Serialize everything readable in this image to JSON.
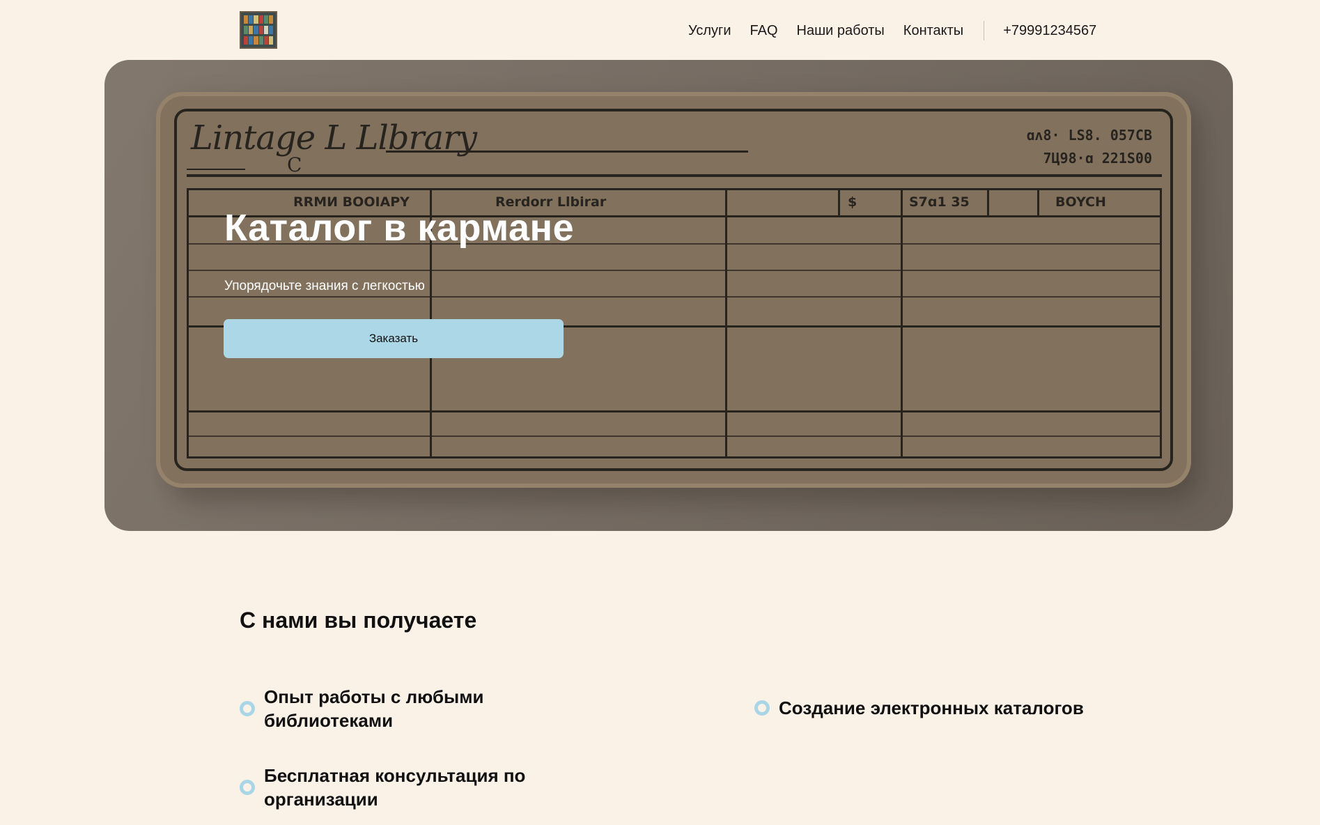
{
  "header": {
    "nav": [
      {
        "label": "Услуги"
      },
      {
        "label": "FAQ"
      },
      {
        "label": "Наши работы"
      },
      {
        "label": "Контакты"
      }
    ],
    "phone": "+79991234567"
  },
  "hero": {
    "title": "Каталог в кармане",
    "subtitle": "Упорядочьте знания с легкостью",
    "cta_label": "Заказать",
    "image": {
      "card_title": "Lintage L Llbrary",
      "card_letter": "C",
      "code_line_1": "ɑʌ8· LS8. 057CB",
      "code_line_2": "7Ц98·ɑ 221S00",
      "headers": [
        "RRMИ BOOIAPY",
        "Rerdorr Llbirar",
        "$",
        "S7ɑ1 35",
        "BOYCH"
      ]
    }
  },
  "benefits": {
    "title": "С нами вы получаете",
    "items": [
      {
        "text": "Опыт работы с любыми библиотеками"
      },
      {
        "text": "Создание электронных каталогов"
      },
      {
        "text": "Бесплатная консультация по организации"
      }
    ]
  },
  "colors": {
    "background": "#faf1e7",
    "accent": "#acd7e6",
    "bullet_ring": "#a9d6e6",
    "text": "#111111"
  },
  "icons": {
    "logo": "bookshelf-logo-icon",
    "bullet": "ring-bullet-icon"
  }
}
